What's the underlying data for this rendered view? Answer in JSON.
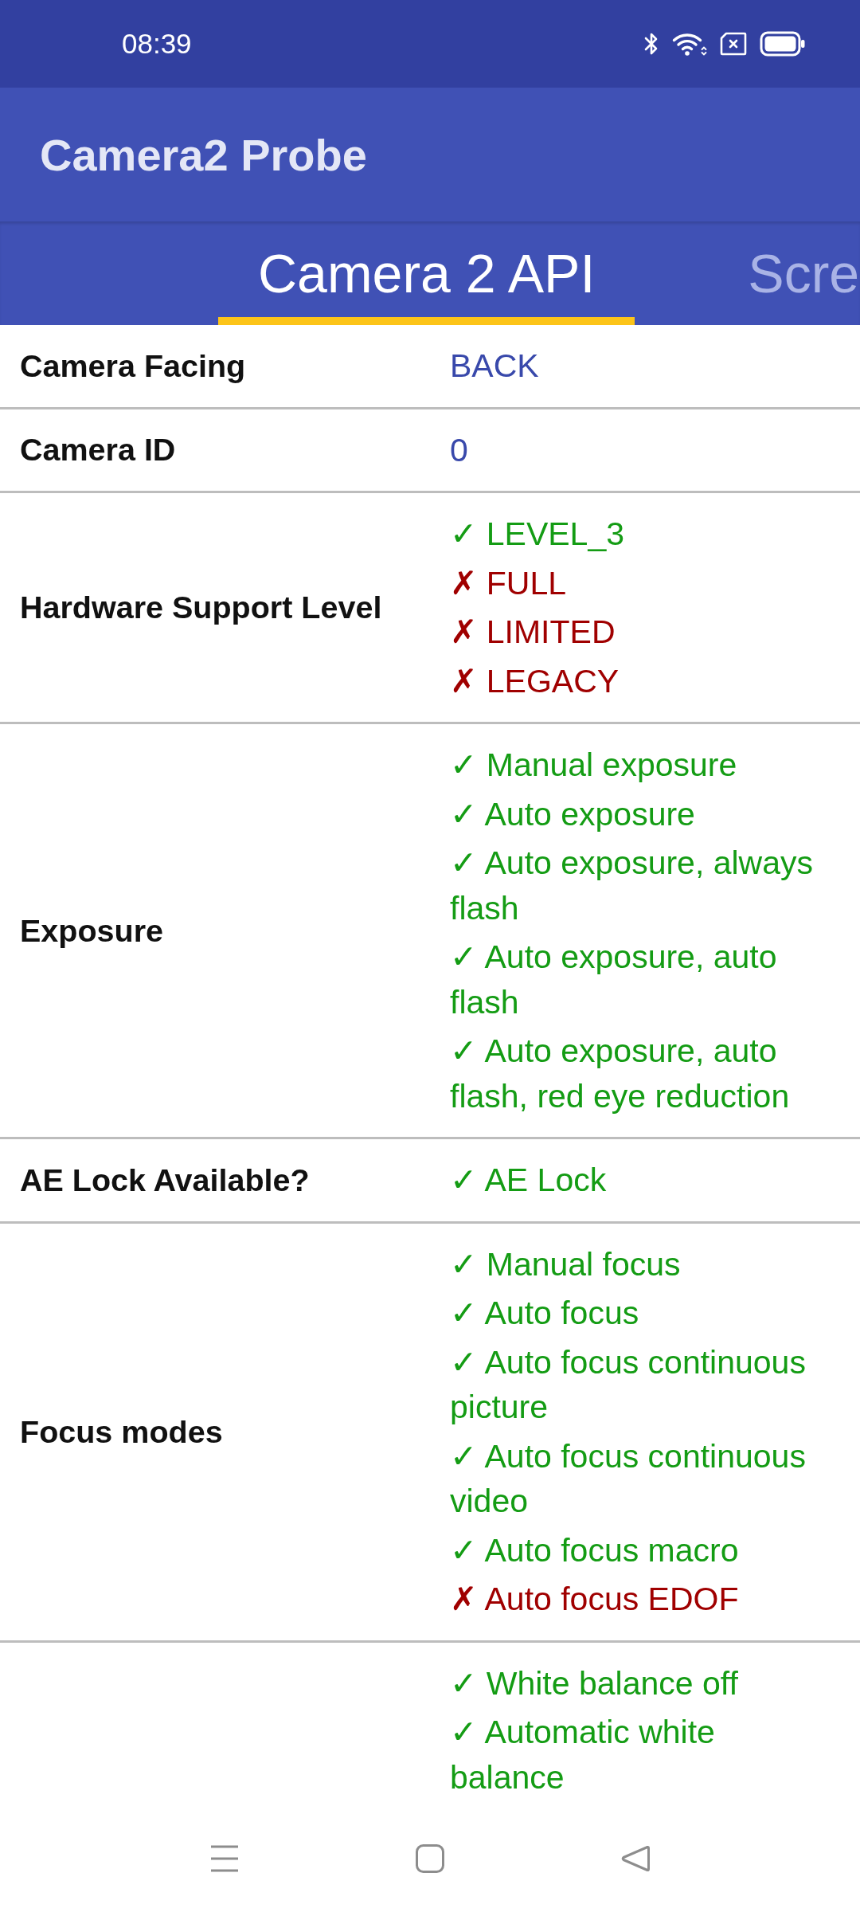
{
  "status_bar": {
    "time": "08:39"
  },
  "app_bar": {
    "title": "Camera2 Probe"
  },
  "tabs": [
    {
      "label": "Camera 2 API",
      "selected": true
    },
    {
      "label": "Scre",
      "selected": false
    }
  ],
  "rows": [
    {
      "label": "Camera Facing",
      "kind": "text",
      "value": "BACK"
    },
    {
      "label": "Camera ID",
      "kind": "text",
      "value": "0"
    },
    {
      "label": "Hardware Support Level",
      "kind": "checklist",
      "items": [
        {
          "mark": "✓",
          "text": "LEVEL_3",
          "supported": true
        },
        {
          "mark": "✗",
          "text": "FULL",
          "supported": false
        },
        {
          "mark": "✗",
          "text": "LIMITED",
          "supported": false
        },
        {
          "mark": "✗",
          "text": "LEGACY",
          "supported": false
        }
      ]
    },
    {
      "label": "Exposure",
      "kind": "checklist",
      "items": [
        {
          "mark": "✓",
          "text": "Manual exposure",
          "supported": true
        },
        {
          "mark": "✓",
          "text": "Auto exposure",
          "supported": true
        },
        {
          "mark": "✓",
          "text": "Auto exposure, always flash",
          "supported": true
        },
        {
          "mark": "✓",
          "text": "Auto exposure, auto flash",
          "supported": true
        },
        {
          "mark": "✓",
          "text": "Auto exposure, auto flash, red eye reduction",
          "supported": true
        }
      ]
    },
    {
      "label": "AE Lock Available?",
      "kind": "checklist",
      "items": [
        {
          "mark": "✓",
          "text": "AE Lock",
          "supported": true
        }
      ]
    },
    {
      "label": "Focus modes",
      "kind": "checklist",
      "items": [
        {
          "mark": "✓",
          "text": "Manual focus",
          "supported": true
        },
        {
          "mark": "✓",
          "text": "Auto focus",
          "supported": true
        },
        {
          "mark": "✓",
          "text": "Auto focus continuous picture",
          "supported": true
        },
        {
          "mark": "✓",
          "text": "Auto focus continuous video",
          "supported": true
        },
        {
          "mark": "✓",
          "text": "Auto focus macro",
          "supported": true
        },
        {
          "mark": "✗",
          "text": "Auto focus EDOF",
          "supported": false
        }
      ]
    },
    {
      "kind": "checklist",
      "items": [
        {
          "mark": "✓",
          "text": "White balance off",
          "supported": true
        },
        {
          "mark": "✓",
          "text": "Automatic white balance",
          "supported": true
        }
      ]
    }
  ]
}
